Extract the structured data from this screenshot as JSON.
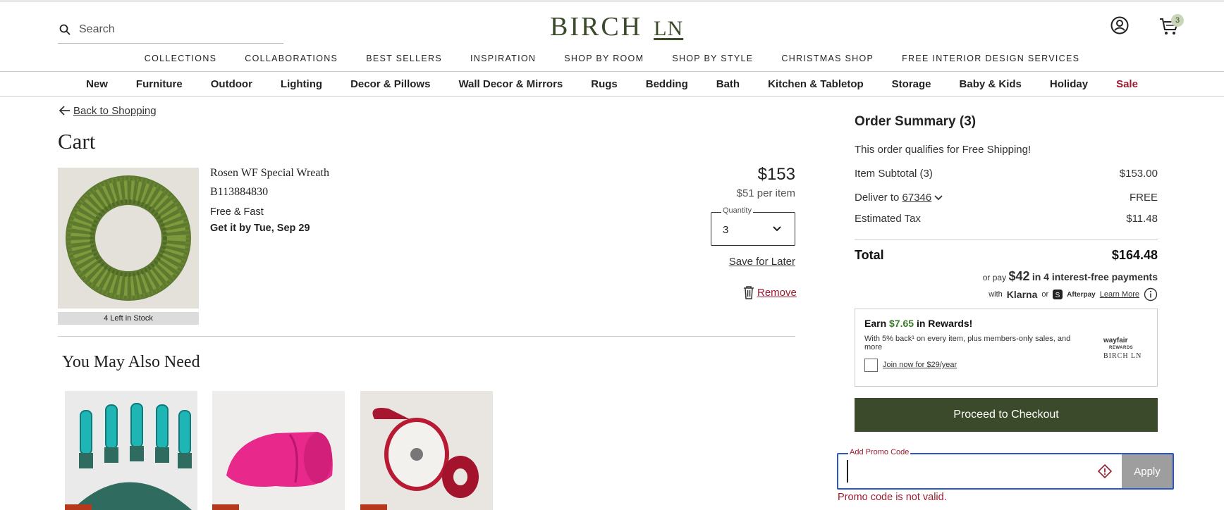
{
  "header": {
    "search_placeholder": "Search",
    "logo_main": "BIRCH",
    "logo_ln": "LN",
    "cart_count": "3"
  },
  "top_nav": [
    "COLLECTIONS",
    "COLLABORATIONS",
    "BEST SELLERS",
    "INSPIRATION",
    "SHOP BY ROOM",
    "SHOP BY STYLE",
    "CHRISTMAS SHOP",
    "FREE INTERIOR DESIGN SERVICES"
  ],
  "categories": [
    "New",
    "Furniture",
    "Outdoor",
    "Lighting",
    "Decor & Pillows",
    "Wall Decor & Mirrors",
    "Rugs",
    "Bedding",
    "Bath",
    "Kitchen & Tabletop",
    "Storage",
    "Baby & Kids",
    "Holiday",
    "Sale"
  ],
  "cart": {
    "back_label": "Back to Shopping",
    "title": "Cart",
    "item": {
      "name": "Rosen WF Special Wreath",
      "sku": "B113884830",
      "shipping": "Free & Fast",
      "delivery": "Get it by Tue, Sep 29",
      "stock": "4 Left in Stock",
      "price": "$153",
      "per_item": "$51 per item",
      "quantity_label": "Quantity",
      "quantity": "3",
      "save_label": "Save for Later",
      "remove_label": "Remove"
    },
    "recommend_title": "You May Also Need"
  },
  "summary": {
    "title": "Order Summary (3)",
    "free_shipping": "This order qualifies for Free Shipping!",
    "subtotal_label": "Item Subtotal (3)",
    "subtotal_value": "$153.00",
    "deliver_label": "Deliver to",
    "zip": "67346",
    "deliver_value": "FREE",
    "tax_label": "Estimated Tax",
    "tax_value": "$11.48",
    "total_label": "Total",
    "total_value": "$164.48",
    "klarna_pre": "or pay",
    "klarna_amount": "$42",
    "klarna_post": "in 4 interest-free payments",
    "klarna_with": "with",
    "klarna_brand": "Klarna",
    "klarna_or": "or",
    "afterpay_brand": "Afterpay",
    "learn_more": "Learn More"
  },
  "rewards": {
    "earn_pre": "Earn",
    "earn_amount": "$7.65",
    "earn_post": "in Rewards!",
    "desc": "With 5% back¹ on every item, plus members-only sales, and more",
    "join": "Join now for $29/year",
    "logo_line1": "wayfair",
    "logo_line2": "REWARDS",
    "logo_line3": "BIRCH LN"
  },
  "checkout_label": "Proceed to Checkout",
  "promo": {
    "label": "Add Promo Code",
    "value": "",
    "apply_label": "Apply",
    "error": "Promo code is not valid."
  },
  "colors": {
    "brand": "#3b4a2a",
    "sale": "#9b1b30",
    "focus": "#2a57c9"
  }
}
